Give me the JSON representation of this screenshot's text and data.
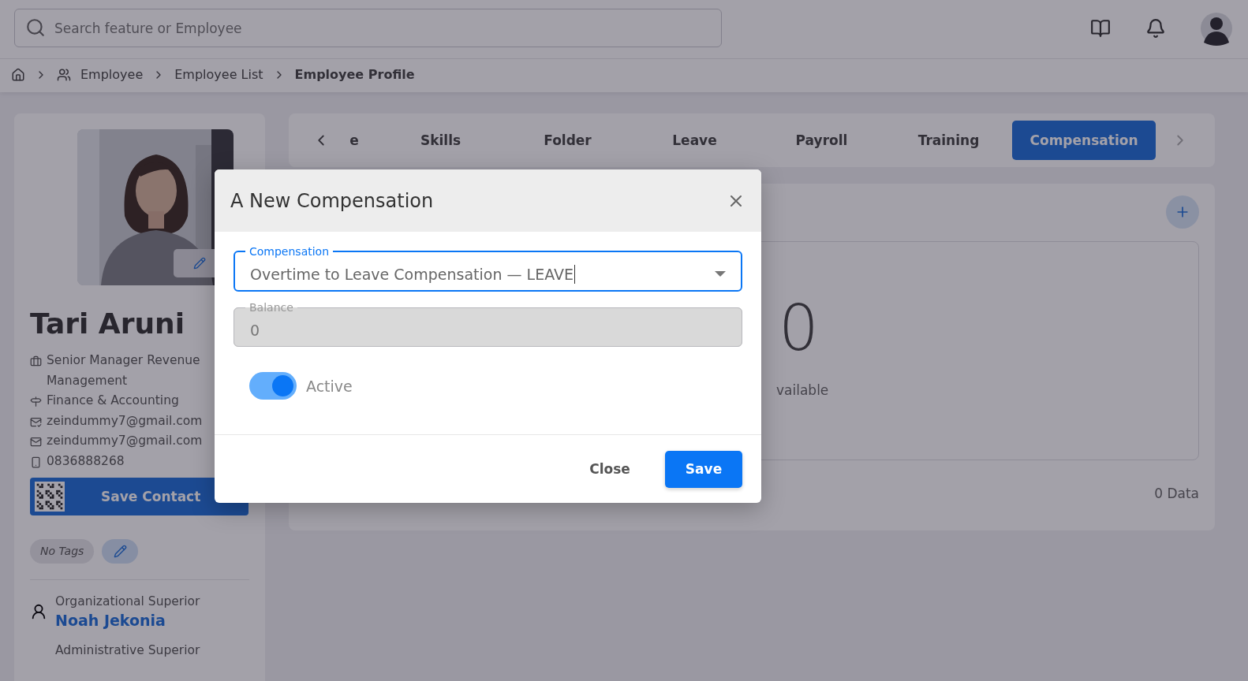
{
  "search": {
    "placeholder": "Search feature or Employee"
  },
  "breadcrumb": [
    {
      "label": "Employee",
      "kind": "group",
      "current": false
    },
    {
      "label": "Employee List",
      "kind": "plain",
      "current": false
    },
    {
      "label": "Employee Profile",
      "kind": "plain",
      "current": true
    }
  ],
  "profile": {
    "name": "Tari Aruni",
    "details": [
      {
        "kind": "job",
        "text": "Senior Manager Revenue Management"
      },
      {
        "kind": "department",
        "text": "Finance & Accounting"
      },
      {
        "kind": "work_email",
        "text": "zeindummy7@gmail.com"
      },
      {
        "kind": "email",
        "text": "zeindummy7@gmail.com"
      },
      {
        "kind": "phone",
        "text": "0836888268"
      }
    ],
    "save_contact": "Save Contact",
    "tags": "No Tags",
    "superiors": [
      {
        "label": "Organizational Superior",
        "name": "Noah Jekonia"
      },
      {
        "label": "Administrative Superior"
      }
    ]
  },
  "tabs": [
    {
      "label": "e",
      "selected": false
    },
    {
      "label": "Skills",
      "selected": false
    },
    {
      "label": "Folder",
      "selected": false
    },
    {
      "label": "Leave",
      "selected": false
    },
    {
      "label": "Payroll",
      "selected": false
    },
    {
      "label": "Training",
      "selected": false
    },
    {
      "label": "Compensation",
      "selected": true
    }
  ],
  "content": {
    "empty_value": "0",
    "empty_text": "vailable",
    "count": "0 Data"
  },
  "dialog": {
    "title": "A New Compensation",
    "fields": [
      {
        "kind": "select",
        "label": "Compensation",
        "value": "Overtime to Leave Compensation — LEAVE",
        "focused": true,
        "disabled": false
      },
      {
        "kind": "number",
        "label": "Balance",
        "value": "0",
        "focused": false,
        "disabled": true
      }
    ],
    "toggle": {
      "label": "Active",
      "on": true
    },
    "buttons": [
      {
        "kind": "text",
        "label": "Close"
      },
      {
        "kind": "primary",
        "label": "Save"
      }
    ]
  }
}
